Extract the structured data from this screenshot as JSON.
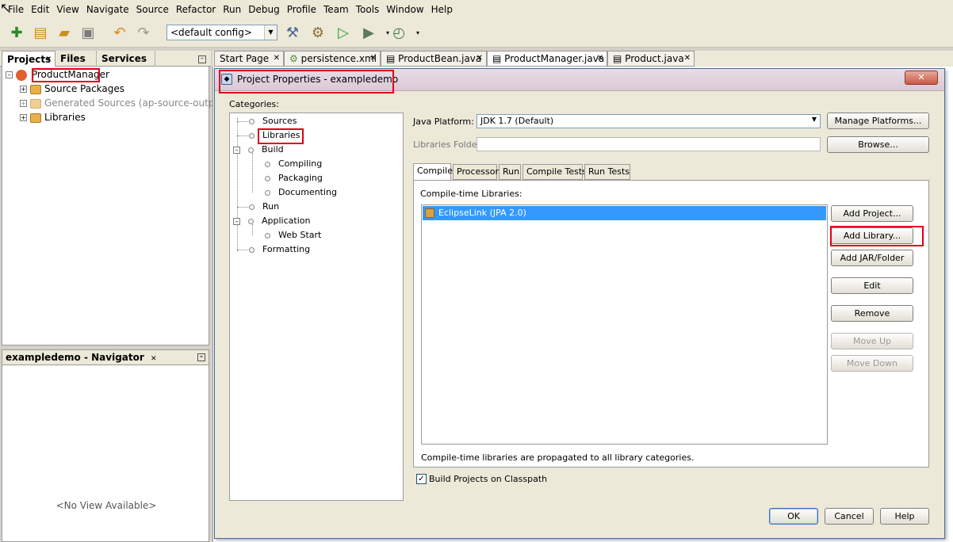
{
  "menu": [
    "File",
    "Edit",
    "View",
    "Navigate",
    "Source",
    "Refactor",
    "Run",
    "Debug",
    "Profile",
    "Team",
    "Tools",
    "Window",
    "Help"
  ],
  "toolbar": {
    "config": "<default config>"
  },
  "left_tabs": {
    "projects": "Projects",
    "files": "Files",
    "services": "Services"
  },
  "project_tree": {
    "root": "ProductManager",
    "children": [
      "Source Packages",
      "Generated Sources (ap-source-output)",
      "Libraries"
    ]
  },
  "navigator": {
    "title": "exampledemo - Navigator",
    "empty": "<No View Available>"
  },
  "editor_tabs": [
    "Start Page",
    "persistence.xml",
    "ProductBean.java",
    "ProductManager.java",
    "Product.java"
  ],
  "dialog": {
    "title": "Project Properties - exampledemo",
    "close": "✕",
    "categories_label": "Categories:",
    "categories": {
      "sources": "Sources",
      "libraries": "Libraries",
      "build": "Build",
      "compiling": "Compiling",
      "packaging": "Packaging",
      "documenting": "Documenting",
      "run": "Run",
      "application": "Application",
      "web_start": "Web Start",
      "formatting": "Formatting"
    },
    "java_platform_label": "Java Platform:",
    "java_platform_value": "JDK 1.7 (Default)",
    "manage_platforms": "Manage Platforms...",
    "libraries_folder_label": "Libraries Folder:",
    "libraries_folder_value": "",
    "browse": "Browse...",
    "tabs": [
      "Compile",
      "Processor",
      "Run",
      "Compile Tests",
      "Run Tests"
    ],
    "compile_libraries_label": "Compile-time Libraries:",
    "libraries": [
      "EclipseLink (JPA 2.0)"
    ],
    "buttons": {
      "add_project": "Add Project...",
      "add_library": "Add Library...",
      "add_jar": "Add JAR/Folder",
      "edit": "Edit",
      "remove": "Remove",
      "move_up": "Move Up",
      "move_down": "Move Down"
    },
    "propagation_note": "Compile-time libraries are propagated to all library categories.",
    "build_on_classpath": "Build Projects on Classpath",
    "build_on_classpath_checked": true,
    "ok": "OK",
    "cancel": "Cancel",
    "help": "Help"
  },
  "highlight_color": "#e0001a",
  "selection_color": "#3399ff"
}
